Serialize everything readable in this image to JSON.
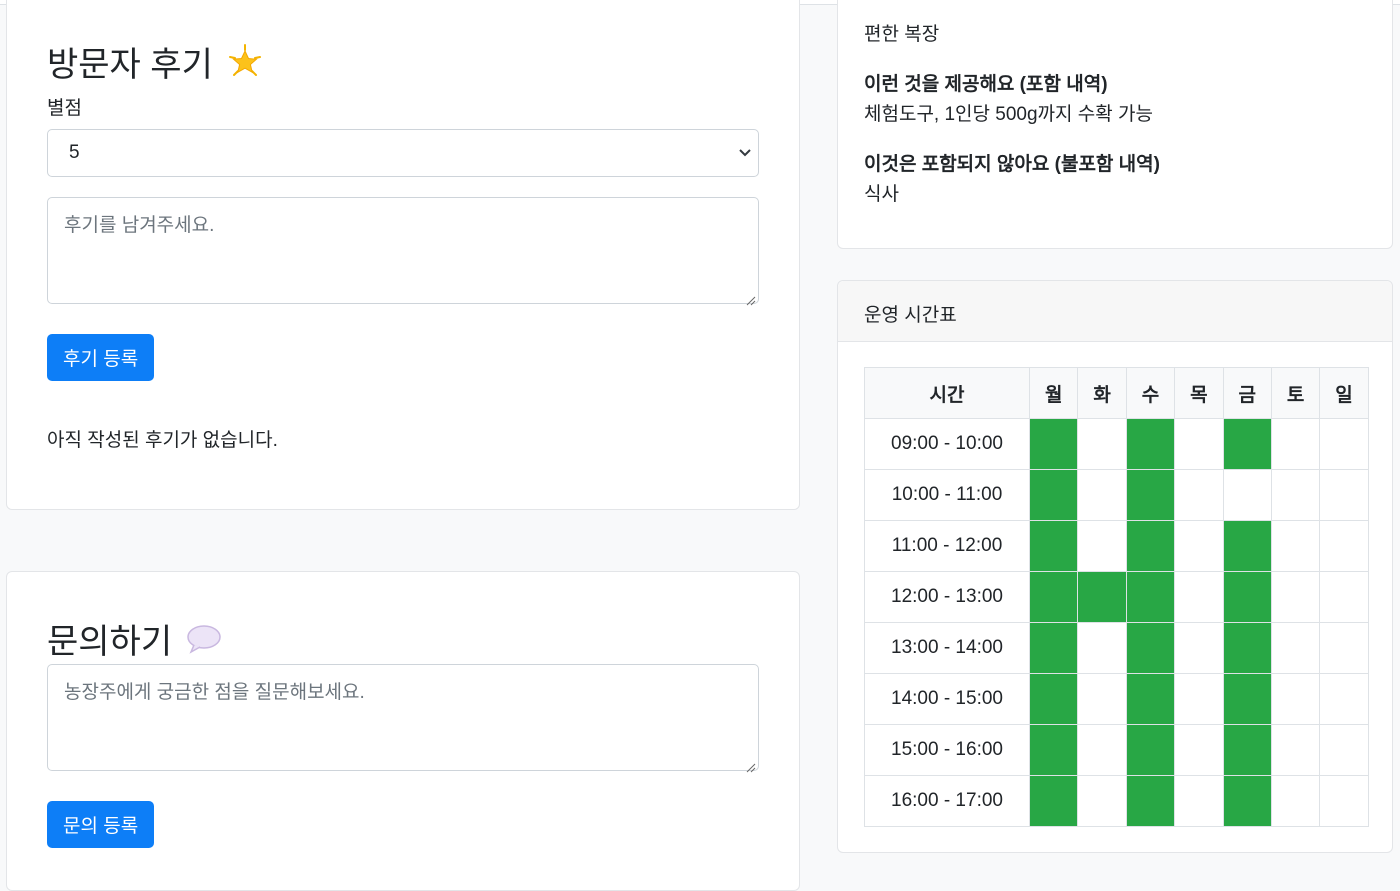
{
  "review": {
    "title": "방문자 후기",
    "title_icon": "star-emoji-icon",
    "rating_label": "별점",
    "rating_value": "5",
    "textarea_placeholder": "후기를 남겨주세요.",
    "submit_label": "후기 등록",
    "empty_text": "아직 작성된 후기가 없습니다."
  },
  "inquiry": {
    "title": "문의하기",
    "title_icon": "speech-bubble-emoji-icon",
    "textarea_placeholder": "농장주에게 궁금한 점을 질문해보세요.",
    "submit_label": "문의 등록"
  },
  "info": {
    "dress_value": "편한 복장",
    "included_label": "이런 것을 제공해요 (포함 내역)",
    "included_value": "체험도구, 1인당 500g까지 수확 가능",
    "excluded_label": "이것은 포함되지 않아요 (불포함 내역)",
    "excluded_value": "식사"
  },
  "schedule": {
    "header": "운영 시간표",
    "time_header": "시간",
    "days": [
      "월",
      "화",
      "수",
      "목",
      "금",
      "토",
      "일"
    ],
    "rows": [
      {
        "time": "09:00 - 10:00",
        "slots": [
          1,
          0,
          1,
          0,
          1,
          0,
          0
        ]
      },
      {
        "time": "10:00 - 11:00",
        "slots": [
          1,
          0,
          1,
          0,
          0,
          0,
          0
        ]
      },
      {
        "time": "11:00 - 12:00",
        "slots": [
          1,
          0,
          1,
          0,
          1,
          0,
          0
        ]
      },
      {
        "time": "12:00 - 13:00",
        "slots": [
          1,
          1,
          1,
          0,
          1,
          0,
          0
        ]
      },
      {
        "time": "13:00 - 14:00",
        "slots": [
          1,
          0,
          1,
          0,
          1,
          0,
          0
        ]
      },
      {
        "time": "14:00 - 15:00",
        "slots": [
          1,
          0,
          1,
          0,
          1,
          0,
          0
        ]
      },
      {
        "time": "15:00 - 16:00",
        "slots": [
          1,
          0,
          1,
          0,
          1,
          0,
          0
        ]
      },
      {
        "time": "16:00 - 17:00",
        "slots": [
          1,
          0,
          1,
          0,
          1,
          0,
          0
        ]
      }
    ],
    "active_color": "#28a745"
  },
  "colors": {
    "primary": "#0d7ef7"
  }
}
